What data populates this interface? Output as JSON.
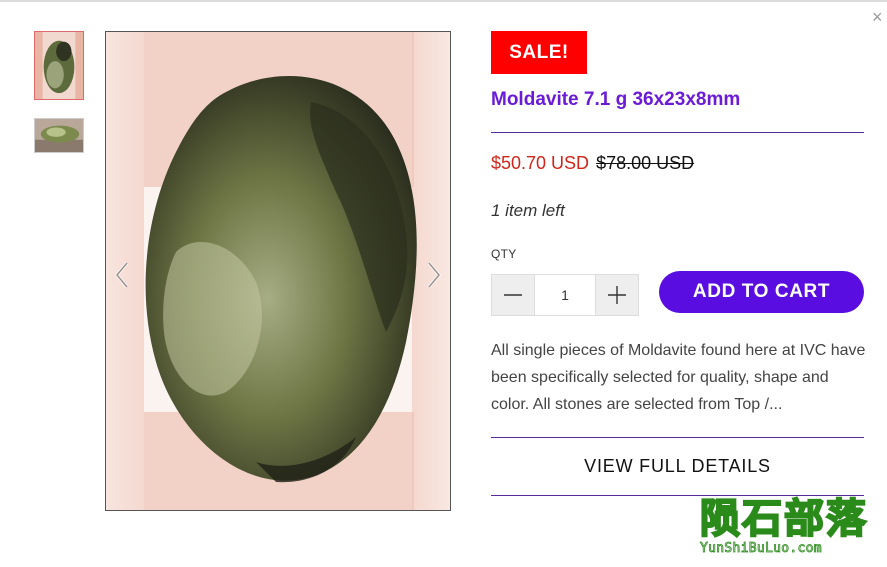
{
  "modal": {
    "close_label": "×"
  },
  "gallery": {
    "thumbnails": [
      {
        "name": "moldavite-front",
        "active": true
      },
      {
        "name": "moldavite-side",
        "active": false
      }
    ],
    "prev_icon": "chevron-left-icon",
    "next_icon": "chevron-right-icon"
  },
  "product": {
    "badge": "SALE!",
    "title": "Moldavite 7.1 g 36x23x8mm",
    "price": "$50.70 USD",
    "compare_price": "$78.00 USD",
    "stock": "1 item left",
    "qty_label": "QTY",
    "qty_value": "1",
    "add_to_cart": "ADD TO CART",
    "description": "All single pieces of Moldavite found here at IVC have been specifically selected for quality, shape and color. All stones are selected from Top /...",
    "details_link": "VIEW FULL DETAILS"
  },
  "watermark": {
    "chars": "陨石部落",
    "url": "YunShiBuLuo.com"
  },
  "colors": {
    "accent": "#5a0de0",
    "title": "#6b1ad6",
    "sale": "#ff0000",
    "price": "#d0261a",
    "watermark": "#2a8a1a"
  }
}
